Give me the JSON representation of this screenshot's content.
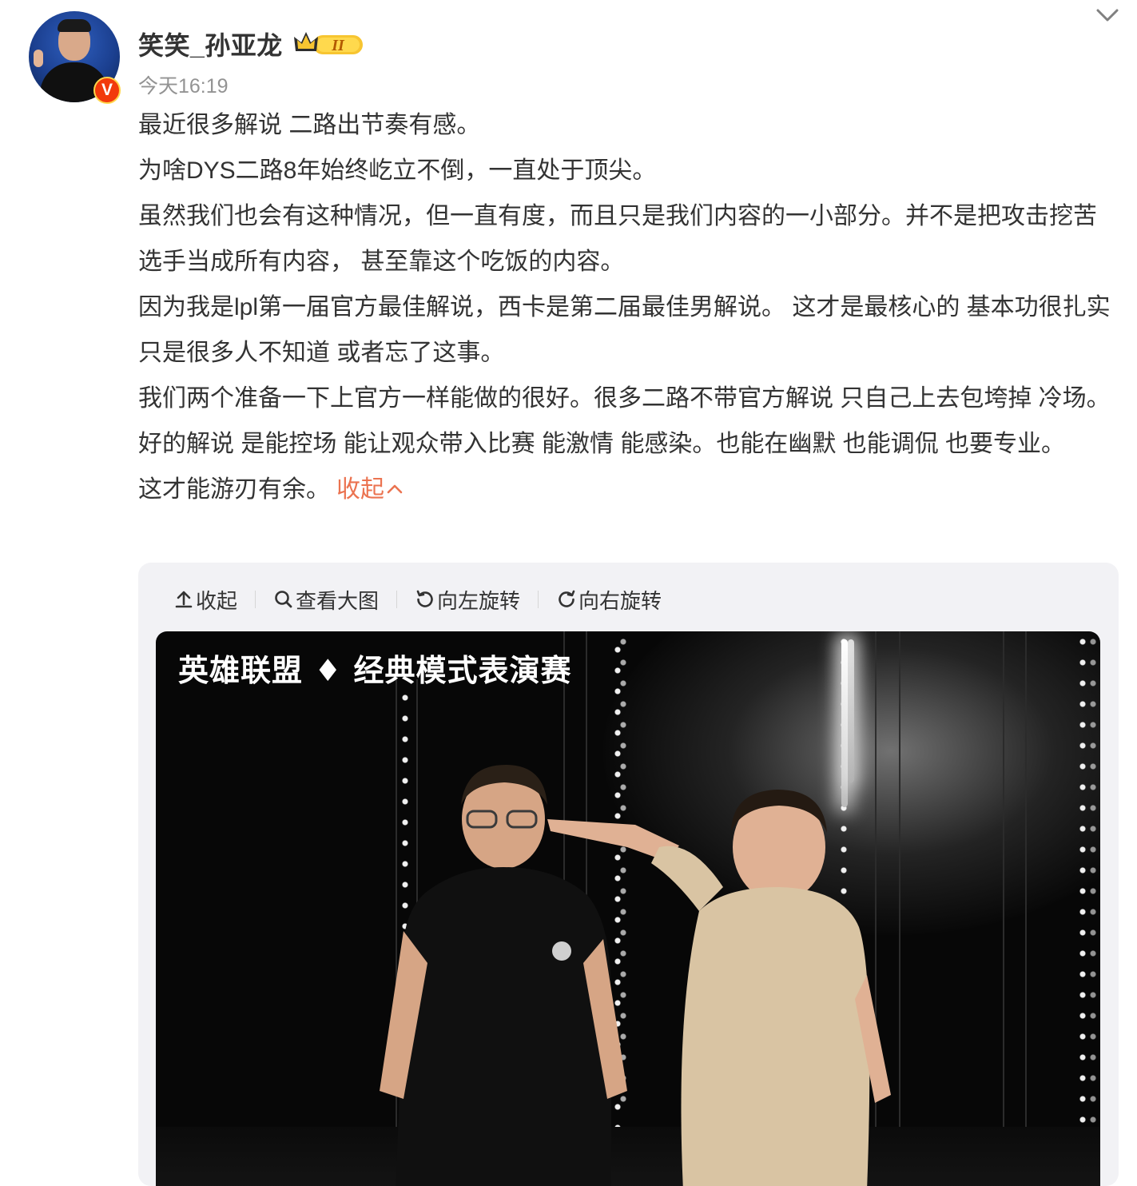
{
  "header": {
    "username": "笑笑_孙亚龙",
    "vip_badge": "II",
    "verified_badge": "V",
    "timestamp": "今天16:19"
  },
  "post": {
    "paragraphs": [
      "最近很多解说 二路出节奏有感。",
      "为啥DYS二路8年始终屹立不倒，一直处于顶尖。",
      "虽然我们也会有这种情况，但一直有度，而且只是我们内容的一小部分。并不是把攻击挖苦选手当成所有内容， 甚至靠这个吃饭的内容。",
      "因为我是lpl第一届官方最佳解说，西卡是第二届最佳男解说。 这才是最核心的 基本功很扎实 只是很多人不知道 或者忘了这事。",
      "我们两个准备一下上官方一样能做的很好。很多二路不带官方解说 只自己上去包垮掉 冷场。",
      "好的解说 是能控场 能让观众带入比赛 能激情 能感染。也能在幽默 也能调侃 也要专业。这才能游刃有余。"
    ],
    "collapse_label": "收起"
  },
  "image_viewer": {
    "toolbar": {
      "collapse": "收起",
      "view_large": "查看大图",
      "rotate_left": "向左旋转",
      "rotate_right": "向右旋转"
    },
    "photo_caption": "英雄联盟 ♦ 经典模式表演赛"
  },
  "colors": {
    "text": "#333333",
    "muted": "#939393",
    "accent_link": "#eb7350",
    "card_bg": "#f2f2f5",
    "verified": "#f23a0b"
  },
  "icons": [
    "chevron-down-icon",
    "crown-icon",
    "upload-arrow-icon",
    "search-icon",
    "rotate-left-icon",
    "rotate-right-icon"
  ]
}
